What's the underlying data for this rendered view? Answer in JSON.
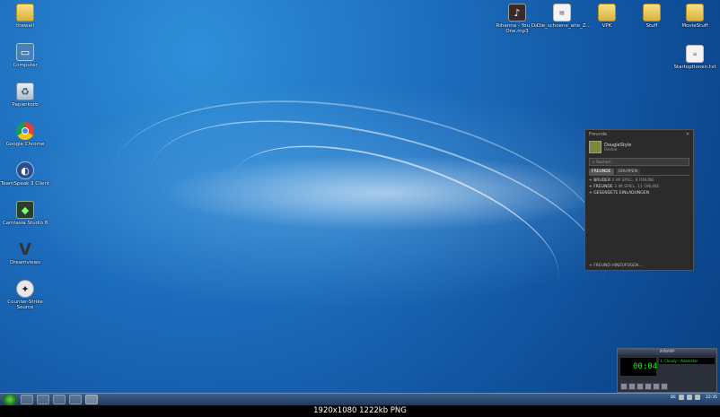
{
  "desktop": {
    "icons_left": [
      {
        "label": "thewall",
        "icon": "folder-icon"
      },
      {
        "label": "Computer",
        "icon": "computer-icon"
      },
      {
        "label": "Papierkorb",
        "icon": "recycle-bin-icon"
      },
      {
        "label": "Google Chrome",
        "icon": "chrome-icon"
      },
      {
        "label": "TeamSpeak 3 Client",
        "icon": "teamspeak-icon"
      },
      {
        "label": "Camtasia Studio 8",
        "icon": "camtasia-icon"
      },
      {
        "label": "Dreamviews",
        "icon": "v-logo-icon"
      },
      {
        "label": "Counter-Strike Source",
        "icon": "cs-icon"
      }
    ],
    "icons_top": [
      {
        "label": "Rihanna - You Da One.mp3",
        "icon": "music-file-icon"
      },
      {
        "label": "Die_schoene_alte_Z...",
        "icon": "file-icon"
      },
      {
        "label": "VPK",
        "icon": "folder-icon"
      },
      {
        "label": "Stuff",
        "icon": "folder-icon"
      },
      {
        "label": "MovieStuff",
        "icon": "folder-icon"
      }
    ],
    "icons_right": [
      {
        "label": "Startoptionen.txt",
        "icon": "text-file-icon"
      }
    ]
  },
  "friends_window": {
    "title": "Freunde",
    "username": "DougieStyle",
    "status": "Online",
    "search_placeholder": "Suchen",
    "tabs": [
      "FREUNDE",
      "GRUPPEN"
    ],
    "rows": [
      {
        "label": "BRUDER",
        "count": "0 IM SPIEL, 8 ONLINE"
      },
      {
        "label": "FREUNDE",
        "count": "3 IM SPIEL, 11 ONLINE"
      },
      {
        "label": "GESENDETE EINLADUNGEN",
        "count": ""
      }
    ],
    "add_friend": "FREUND HINZUFÜGEN..."
  },
  "winamp": {
    "title": "WINAMP",
    "time": "00:04",
    "track": "1. Cloudy - Adamstar"
  },
  "taskbar": {
    "clock": "22:35",
    "lang": "DE"
  },
  "caption": "1920x1080  1222kb  PNG"
}
